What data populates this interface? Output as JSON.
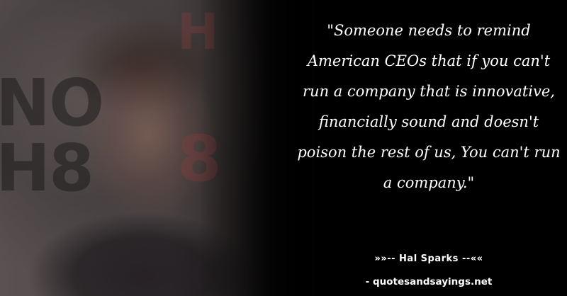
{
  "background": {
    "wall_letters": [
      "NO",
      "H8",
      "H",
      "8"
    ]
  },
  "quote": {
    "text": "\"Someone needs to remind American CEOs that if you can't run a company that is innovative, financially sound and doesn't poison the rest of us, You can't run a company.\""
  },
  "author": {
    "line": "»»-- Hal Sparks --««"
  },
  "source": {
    "line": "- quotesandsayings.net"
  },
  "colors": {
    "background": "#000000",
    "text": "#ffffff"
  }
}
